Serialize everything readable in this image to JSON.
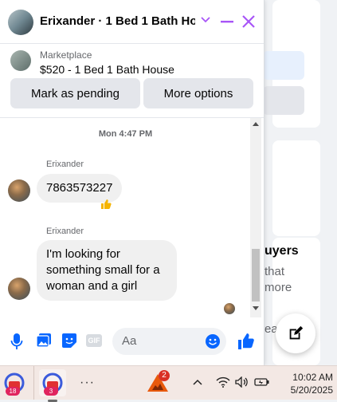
{
  "background": {
    "buyers_text": "uyers",
    "that_text": "that",
    "more_text": "more",
    "learn_text": "ear"
  },
  "chat": {
    "title": "Erixander · 1 Bed 1 Bath Hou…",
    "marketplace_label": "Marketplace",
    "listing": "$520 - 1 Bed 1 Bath House",
    "mark_pending_label": "Mark as pending",
    "more_options_label": "More options",
    "timestamp": "Mon 4:47 PM",
    "messages": [
      {
        "sender": "Erixander",
        "text": "7863573227",
        "reaction": "thumbs-up"
      },
      {
        "sender": "Erixander",
        "text": "I'm looking for something small for a woman and a girl"
      }
    ],
    "composer": {
      "placeholder": "Aa",
      "icons": [
        "microphone-icon",
        "photo-icon",
        "sticker-icon",
        "gif-icon",
        "emoji-icon",
        "thumbs-up-icon"
      ],
      "gif_label": "GIF"
    },
    "accent_color": "#a855f7",
    "messenger_blue": "#0866ff"
  },
  "taskbar": {
    "app1_badge": "18",
    "app2_badge": "3",
    "more_label": "···",
    "notification_count": "2",
    "time": "10:02 AM",
    "date": "5/20/2025"
  }
}
